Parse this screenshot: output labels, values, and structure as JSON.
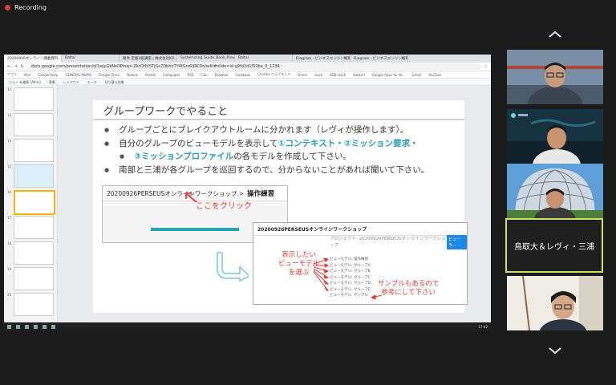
{
  "recording": {
    "label": "Recording"
  },
  "browser": {
    "tabs": [
      "20200926オンライン講義資料 - G",
      "Baltai",
      "要件 定義1級講座 | 株式会社KO...",
      "Systemizing Guide_Book_Preved...",
      "Baltai",
      "Diagram - ビジネスエンジン概要",
      "Diagram - ビジネスエンジン概要"
    ],
    "url": "docs.google.com/presentation/d/1wjyGkNeDPinwn-ZkrQHVSTjGs7DbhuTY4fGrs6lJRC0o/edit#slide=id.g9fd2d1f50ba_0_1734",
    "bookmarks": [
      "アプリ",
      "Mail",
      "Google Keep",
      "GENERAL MEMO",
      "Google Drive",
      "Todoist",
      "Pocket",
      "Instapaper",
      "RSS",
      "C&L",
      "Dropbox",
      "Facebook",
      "Chrome ウェブストア",
      "Home",
      "slack",
      "KDB slack",
      "bookml",
      "Google Apps for W...",
      "Gmail",
      "YouTube"
    ],
    "slides_toolbar": [
      "ニュー を検索 (Alt+/)",
      "背景",
      "レイアウト",
      "テーマ",
      "切り替え効果"
    ]
  },
  "filmstrip": {
    "numbers": [
      "12",
      "13",
      "14",
      "15",
      "16",
      "17",
      "18",
      "19",
      "20"
    ]
  },
  "slide": {
    "title": "グループワークでやること",
    "b1": "グループごとにブレイクアウトルームに分かれます（レヴィが操作します）。",
    "b2_pre": "自分のグループのビューモデルを表示して",
    "b2_hl1": "①コンテキスト・②ミッション要求・",
    "b2_hl2": "③ミッションプロファイル",
    "b2_post": "の各モデルを作成して下さい。",
    "b3": "南部と三浦が各グループを巡回するので、分からないことがあれば聞いて下さい。",
    "shot1": {
      "path": "20200926PERSEUSオンラインワークショップ >",
      "bold": "操作練習",
      "click": "ここをクリック"
    },
    "shot2": {
      "header": "20200926PERSEUSオンラインワークショップ",
      "project": "プロジェクト: 20200926PERSEUSオンラインワークショップ",
      "button": "ビューモ...",
      "models": [
        "ビューモデル: 操作練習",
        "ビューモデル: グループA",
        "ビューモデル: グループB",
        "ビューモデル: グループC",
        "ビューモデル: グループD",
        "ビューモデル: グループE",
        "ビューモデル: サンプル"
      ],
      "note1a": "表示したい",
      "note1b": "ビューモデル",
      "note1c": "を選ぶ",
      "note2a": "サンプルもあるので",
      "note2b": "参考にして下さい"
    }
  },
  "taskbar": {
    "clock": "17:42"
  },
  "participants": [
    {
      "kind": "video",
      "desc": "man with glasses, Golden Gate background"
    },
    {
      "kind": "video",
      "desc": "man in front of map screen"
    },
    {
      "kind": "video",
      "desc": "man in front of dome structure"
    },
    {
      "kind": "name",
      "name": "鳥取大＆レヴィ・三浦"
    },
    {
      "kind": "video",
      "desc": "young man with glasses"
    }
  ],
  "colors": {
    "highlight": "#2a9bb0",
    "annotation": "#e53935",
    "active_border": "#c9e265"
  }
}
